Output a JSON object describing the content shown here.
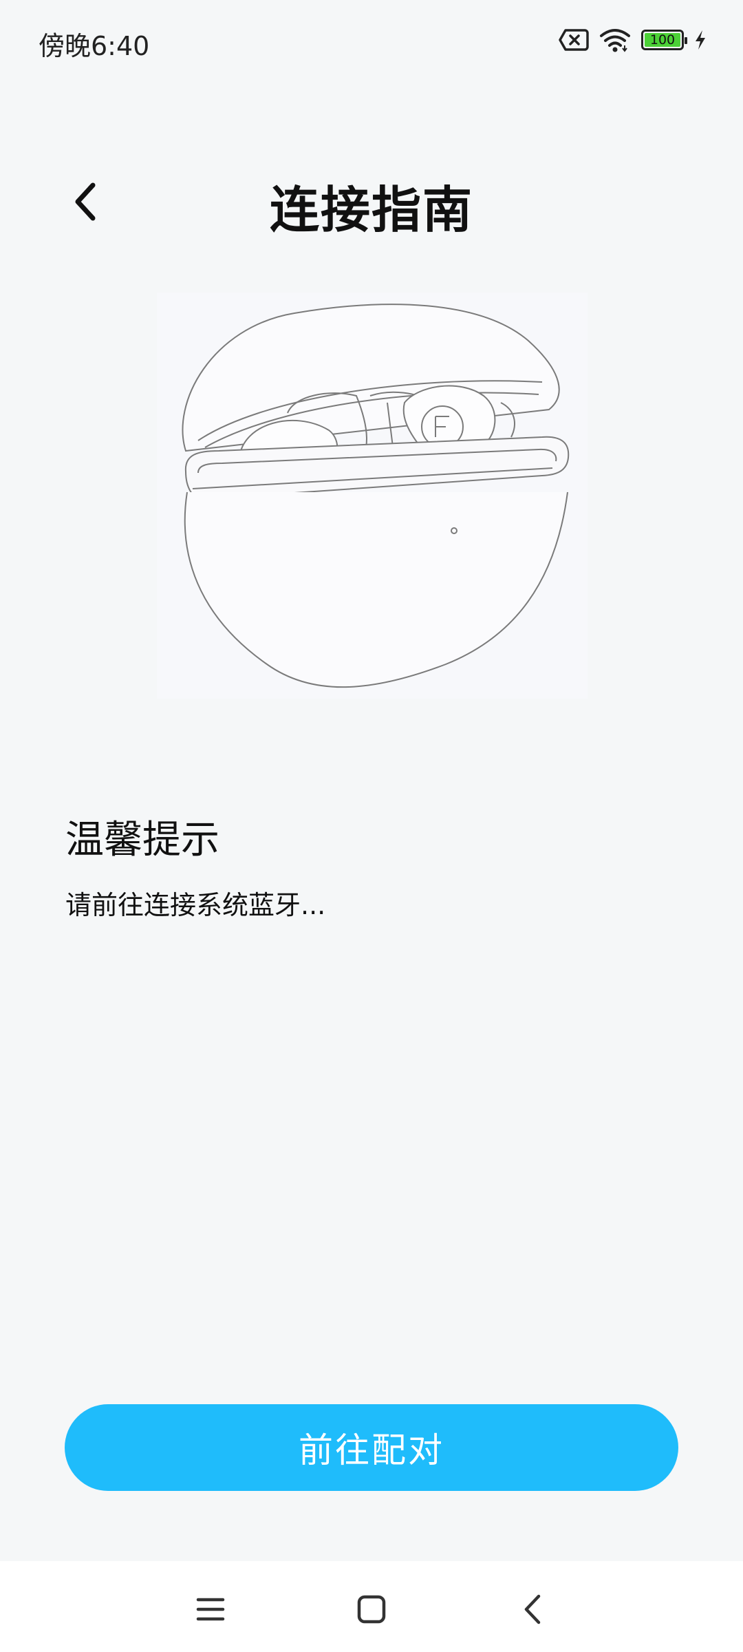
{
  "status_bar": {
    "time": "傍晚6:40",
    "battery_level": "100",
    "battery_color": "#4cd137",
    "icons": [
      "sim-error-icon",
      "wifi-icon",
      "battery-icon",
      "charging-bolt-icon"
    ]
  },
  "header": {
    "title": "连接指南",
    "back_icon": "chevron-left-icon"
  },
  "illustration": {
    "subject": "earbuds-in-charging-case-line-drawing"
  },
  "tips": {
    "title": "温馨提示",
    "message": "请前往连接系统蓝牙..."
  },
  "actions": {
    "pair_label": "前往配对",
    "pair_color": "#1fbcfb"
  },
  "nav_bar": {
    "icons": [
      "menu-icon",
      "home-icon",
      "back-icon"
    ]
  }
}
